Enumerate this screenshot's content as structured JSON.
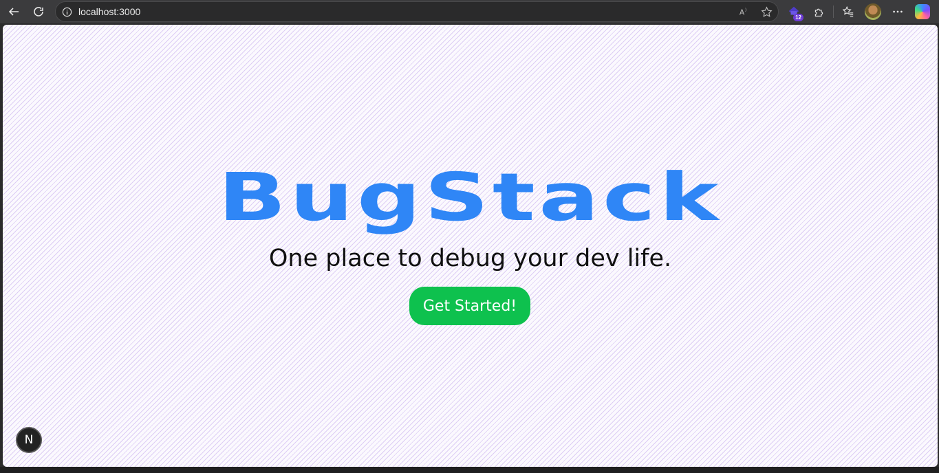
{
  "browser": {
    "url": "localhost:3000",
    "extension_badge": "12",
    "icons": {
      "back": "arrow-left-icon",
      "reload": "reload-icon",
      "info": "info-icon",
      "read_aloud": "read-aloud-icon",
      "favorite": "star-icon",
      "extension": "extension-icon",
      "puzzle": "puzzle-icon",
      "favorites": "favorites-icon",
      "profile": "avatar",
      "more": "more-icon",
      "copilot": "copilot-icon"
    }
  },
  "page": {
    "logo_text": "BugStack",
    "tagline": "One place to debug your dev life.",
    "cta_label": "Get Started!",
    "next_indicator": "N"
  },
  "colors": {
    "logo": "#2f86f6",
    "cta_bg": "#0ec14e",
    "page_bg": "#fbf9fe",
    "stripe": "#c4aaec"
  }
}
